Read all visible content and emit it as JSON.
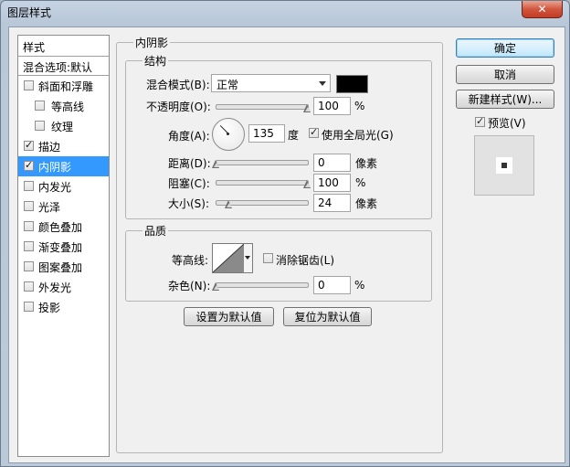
{
  "window": {
    "title": "图层样式",
    "close_glyph": "✕"
  },
  "styles_panel": {
    "header": "样式",
    "blend_options": "混合选项:默认",
    "items": [
      {
        "label": "斜面和浮雕",
        "checked": false,
        "sub": false,
        "selected": false
      },
      {
        "label": "等高线",
        "checked": false,
        "sub": true,
        "selected": false
      },
      {
        "label": "纹理",
        "checked": false,
        "sub": true,
        "selected": false
      },
      {
        "label": "描边",
        "checked": true,
        "sub": false,
        "selected": false
      },
      {
        "label": "内阴影",
        "checked": true,
        "sub": false,
        "selected": true
      },
      {
        "label": "内发光",
        "checked": false,
        "sub": false,
        "selected": false
      },
      {
        "label": "光泽",
        "checked": false,
        "sub": false,
        "selected": false
      },
      {
        "label": "颜色叠加",
        "checked": false,
        "sub": false,
        "selected": false
      },
      {
        "label": "渐变叠加",
        "checked": false,
        "sub": false,
        "selected": false
      },
      {
        "label": "图案叠加",
        "checked": false,
        "sub": false,
        "selected": false
      },
      {
        "label": "外发光",
        "checked": false,
        "sub": false,
        "selected": false
      },
      {
        "label": "投影",
        "checked": false,
        "sub": false,
        "selected": false
      }
    ]
  },
  "inner_shadow": {
    "title": "内阴影",
    "structure": {
      "title": "结构",
      "blend_mode_label": "混合模式(B):",
      "blend_mode_value": "正常",
      "shadow_color": "#000000",
      "opacity_label": "不透明度(O):",
      "opacity_value": "100",
      "opacity_unit": "%",
      "opacity_level": 100,
      "angle_label": "角度(A):",
      "angle_value": "135",
      "angle_unit": "度",
      "global_light_label": "使用全局光(G)",
      "global_light_checked": true,
      "distance_label": "距离(D):",
      "distance_value": "0",
      "distance_unit": "像素",
      "distance_level": 0,
      "choke_label": "阻塞(C):",
      "choke_value": "100",
      "choke_unit": "%",
      "choke_level": 100,
      "size_label": "大小(S):",
      "size_value": "24",
      "size_unit": "像素",
      "size_level": 10
    },
    "quality": {
      "title": "品质",
      "contour_label": "等高线:",
      "anti_alias_label": "消除锯齿(L)",
      "anti_alias_checked": false,
      "noise_label": "杂色(N):",
      "noise_value": "0",
      "noise_unit": "%",
      "noise_level": 0
    },
    "make_default": "设置为默认值",
    "reset_default": "复位为默认值"
  },
  "buttons": {
    "ok": "确定",
    "cancel": "取消",
    "new_style": "新建样式(W)...",
    "preview_label": "预览(V)",
    "preview_checked": true
  }
}
